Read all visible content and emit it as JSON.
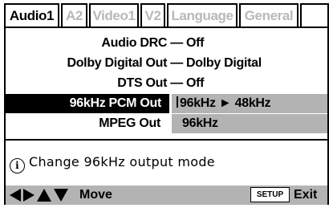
{
  "tabs": [
    {
      "label": "Audio1",
      "active": true
    },
    {
      "label": "A2",
      "active": false
    },
    {
      "label": "Video1",
      "active": false
    },
    {
      "label": "V2",
      "active": false
    },
    {
      "label": "Language",
      "active": false
    },
    {
      "label": "General",
      "active": false
    }
  ],
  "settings": [
    {
      "label": "Audio DRC",
      "separator": "—",
      "value": "Off"
    },
    {
      "label": "Dolby Digital Out",
      "separator": "—",
      "value": "Dolby Digital"
    },
    {
      "label": "DTS Out",
      "separator": "—",
      "value": "Off"
    },
    {
      "label": "96kHz PCM Out",
      "value": "96kHz",
      "arrow": "►",
      "target": "48kHz",
      "selected": true
    },
    {
      "label": "MPEG Out",
      "value": "96kHz"
    }
  ],
  "info": {
    "icon": "info-icon",
    "text": "Change 96kHz output mode"
  },
  "footer": {
    "nav_icons": [
      "left-arrow-icon",
      "right-arrow-icon",
      "up-arrow-icon",
      "down-arrow-icon"
    ],
    "move_label": "Move",
    "setup_label": "SETUP",
    "exit_label": "Exit"
  },
  "colors": {
    "highlight": "#000000",
    "option_background": "#b3b3b3",
    "inactive_tab_text": "#b8b8b8"
  }
}
